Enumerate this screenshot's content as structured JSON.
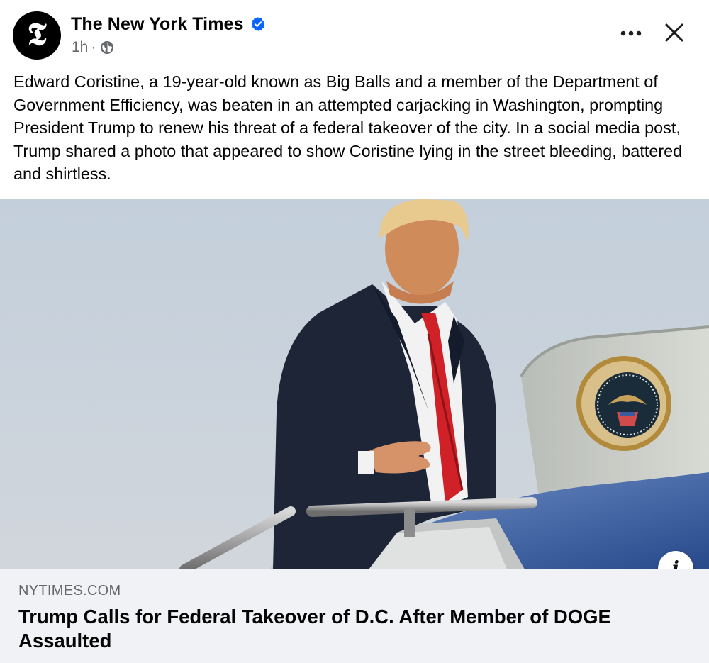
{
  "post": {
    "author": {
      "name": "The New York Times",
      "avatar_glyph": "𝕿",
      "verified": true
    },
    "time": "1h",
    "separator": "·",
    "audience_icon": "globe-icon",
    "text": "Edward Coristine, a 19-year-old known as Big Balls and a member of the Department of Government Efficiency, was beaten in an attempted carjacking in Washington, prompting President Trump to renew his threat of a federal takeover of the city. In a social media post, Trump shared a photo that appeared to show Coristine lying in the street bleeding, battered and shirtless.",
    "actions": {
      "more_icon": "more-horizontal-icon",
      "close_icon": "close-icon"
    }
  },
  "link_preview": {
    "domain": "NYTIMES.COM",
    "title": "Trump Calls for Federal Takeover of D.C. After Member of DOGE Assaulted",
    "info_glyph": "i"
  },
  "colors": {
    "verified_blue": "#0866ff",
    "secondary_text": "#65676b",
    "link_card_bg": "#f0f2f5",
    "sky": "#c9d2dc"
  }
}
